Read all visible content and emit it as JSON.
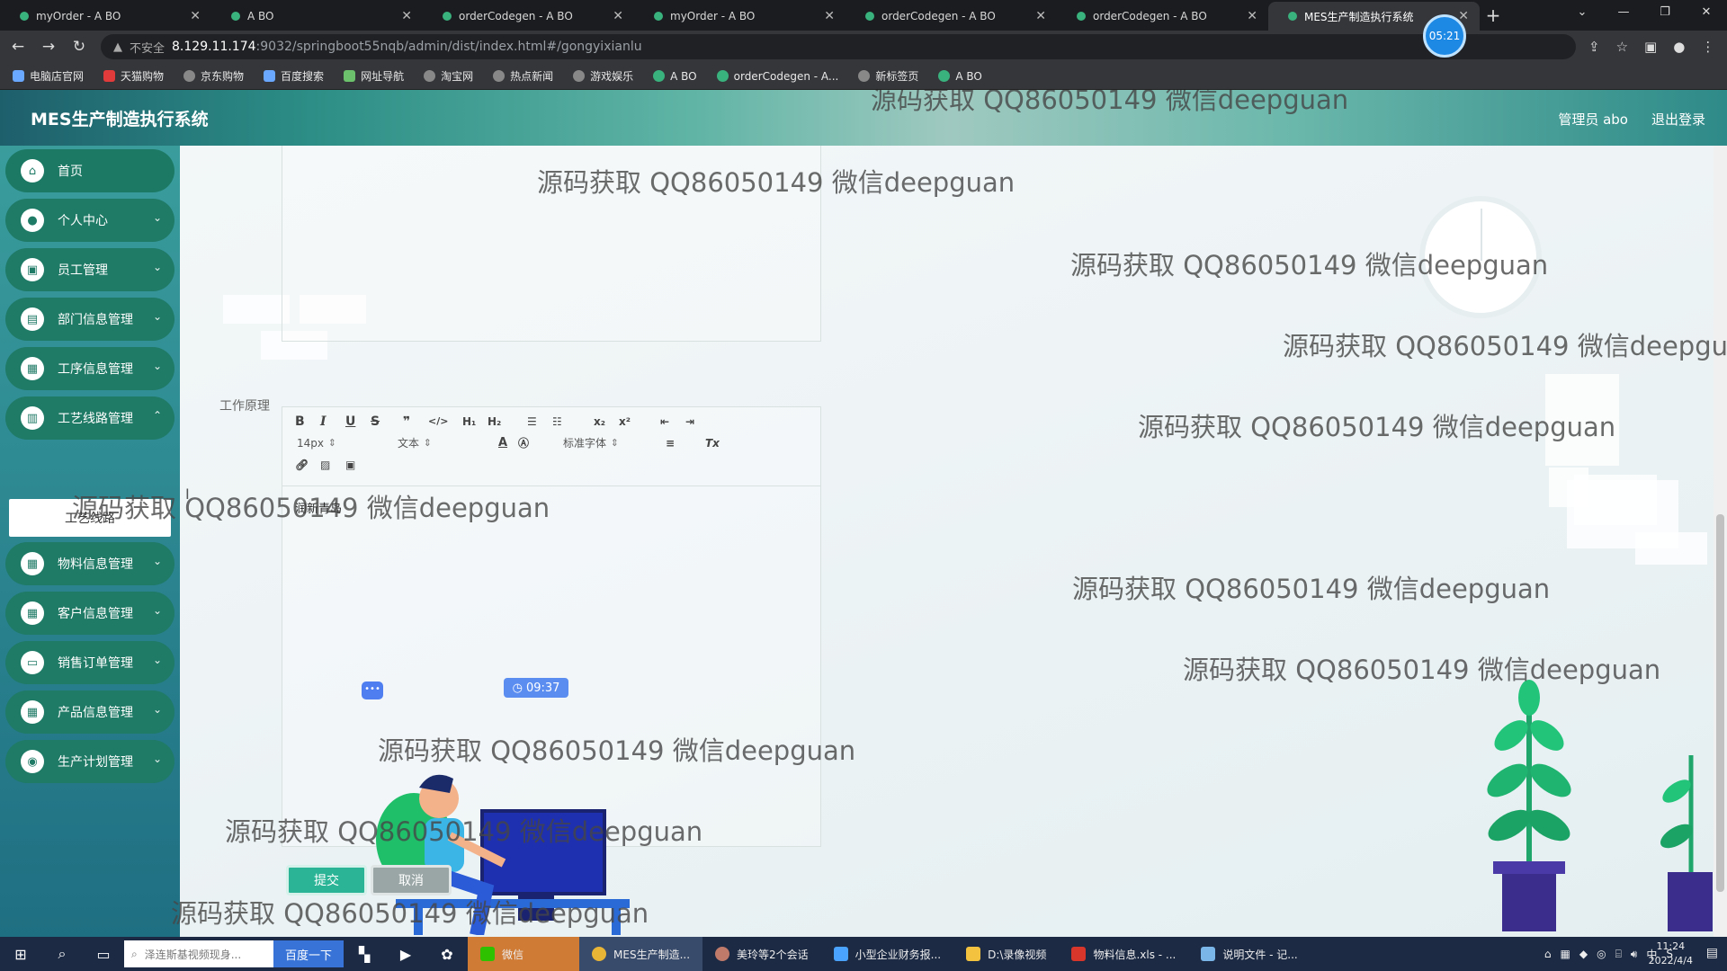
{
  "browser": {
    "tabs": [
      {
        "title": "myOrder - A BO"
      },
      {
        "title": "A BO"
      },
      {
        "title": "orderCodegen - A BO"
      },
      {
        "title": "myOrder - A BO"
      },
      {
        "title": "orderCodegen - A BO"
      },
      {
        "title": "orderCodegen - A BO"
      },
      {
        "title": "MES生产制造执行系统"
      }
    ],
    "recording_time": "05:21",
    "address": {
      "security": "不安全",
      "host": "8.129.11.174",
      "path": ":9032/springboot55nqb/admin/dist/index.html#/gongyixianlu"
    },
    "bookmarks": [
      "电脑店官网",
      "天猫购物",
      "京东购物",
      "百度搜索",
      "网址导航",
      "淘宝网",
      "热点新闻",
      "游戏娱乐",
      "A BO",
      "orderCodegen - A...",
      "新标签页",
      "A BO"
    ]
  },
  "app": {
    "title": "MES生产制造执行系统",
    "user_label": "管理员 abo",
    "logout_label": "退出登录",
    "menu": [
      {
        "label": "首页"
      },
      {
        "label": "个人中心"
      },
      {
        "label": "员工管理"
      },
      {
        "label": "部门信息管理"
      },
      {
        "label": "工序信息管理"
      },
      {
        "label": "工艺线路管理"
      },
      {
        "label": "物料信息管理"
      },
      {
        "label": "客户信息管理"
      },
      {
        "label": "销售订单管理"
      },
      {
        "label": "产品信息管理"
      },
      {
        "label": "生产计划管理"
      }
    ],
    "submenu_active": "工艺线路",
    "form": {
      "field_label": "工作原理",
      "toolbar": {
        "font_size": "14px",
        "text_style": "文本",
        "font_family": "标准字体"
      },
      "editor_text": "润新青岛",
      "submit_label": "提交",
      "cancel_label": "取消"
    },
    "illustration_time": "09:37"
  },
  "watermark_text": "源码获取 QQ86050149 微信deepguan",
  "taskbar": {
    "search_placeholder": "泽连斯基视频现身...",
    "search_button": "百度一下",
    "apps": [
      {
        "label": "微信"
      },
      {
        "label": "MES生产制造..."
      },
      {
        "label": "美玲等2个会话"
      },
      {
        "label": "小型企业财务报..."
      },
      {
        "label": "D:\\录像视频"
      },
      {
        "label": "物料信息.xls - ..."
      },
      {
        "label": "说明文件 - 记..."
      }
    ],
    "ime": "中",
    "time": "11:24",
    "date": "2022/4/4"
  },
  "colors": {
    "menu_item": "#1f7a66",
    "submit": "#2bb596",
    "cancel": "#9aa6a6",
    "topbar_accent": "#2c8e86"
  }
}
